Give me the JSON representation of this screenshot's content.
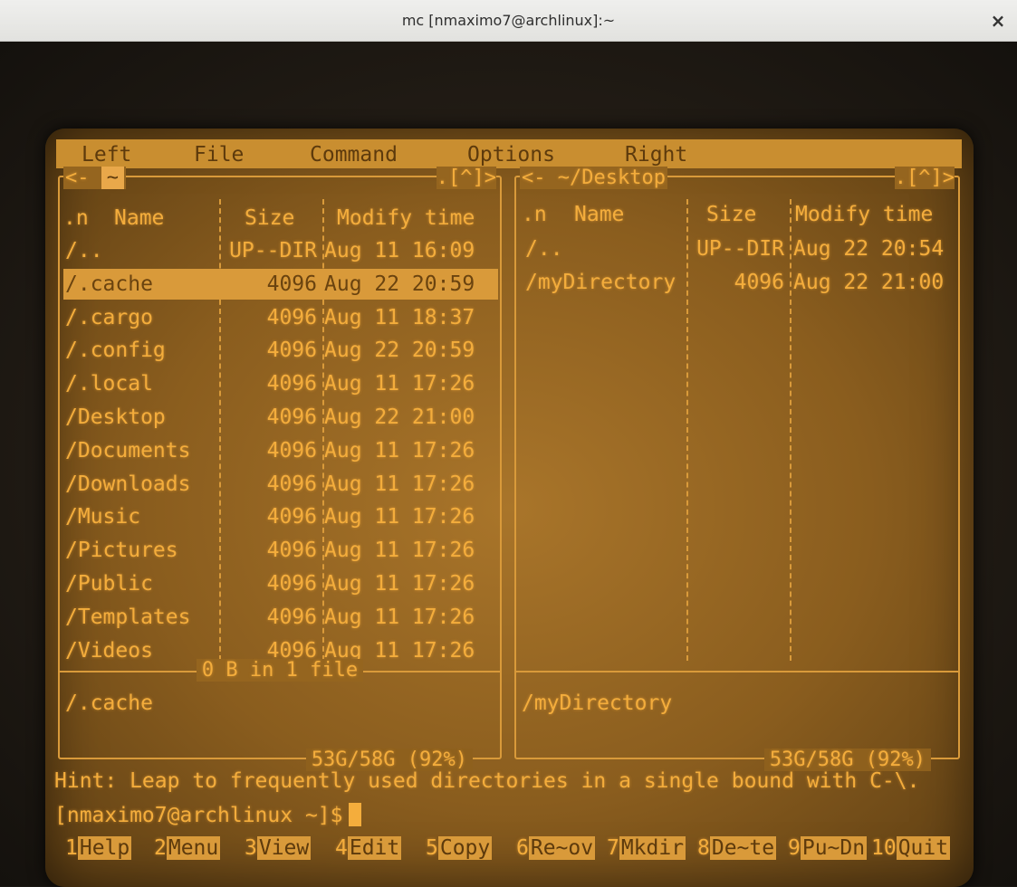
{
  "window": {
    "title": "mc [nmaximo7@archlinux]:~",
    "close_label": "×"
  },
  "menu": [
    "Left",
    "File",
    "Command",
    "Options",
    "Right"
  ],
  "left_panel": {
    "path": "~",
    "corner": ".[^]>",
    "headers": {
      "n": ".n",
      "name": "Name",
      "size": "Size",
      "mtime": "Modify time"
    },
    "rows": [
      {
        "name": "/..",
        "size": "UP--DIR",
        "mtime": "Aug 11 16:09"
      },
      {
        "name": "/.cache",
        "size": "4096",
        "mtime": "Aug 22 20:59"
      },
      {
        "name": "/.cargo",
        "size": "4096",
        "mtime": "Aug 11 18:37"
      },
      {
        "name": "/.config",
        "size": "4096",
        "mtime": "Aug 22 20:59"
      },
      {
        "name": "/.local",
        "size": "4096",
        "mtime": "Aug 11 17:26"
      },
      {
        "name": "/Desktop",
        "size": "4096",
        "mtime": "Aug 22 21:00"
      },
      {
        "name": "/Documents",
        "size": "4096",
        "mtime": "Aug 11 17:26"
      },
      {
        "name": "/Downloads",
        "size": "4096",
        "mtime": "Aug 11 17:26"
      },
      {
        "name": "/Music",
        "size": "4096",
        "mtime": "Aug 11 17:26"
      },
      {
        "name": "/Pictures",
        "size": "4096",
        "mtime": "Aug 11 17:26"
      },
      {
        "name": "/Public",
        "size": "4096",
        "mtime": "Aug 11 17:26"
      },
      {
        "name": "/Templates",
        "size": "4096",
        "mtime": "Aug 11 17:26"
      },
      {
        "name": "/Videos",
        "size": "4096",
        "mtime": "Aug 11 17:26"
      }
    ],
    "selected_index": 1,
    "mini_info": "0 B in 1 file",
    "mini_name": "/.cache",
    "disk": "53G/58G (92%)"
  },
  "right_panel": {
    "path": "<- ~/Desktop",
    "corner": ".[^]>",
    "headers": {
      "n": ".n",
      "name": "Name",
      "size": "Size",
      "mtime": "Modify time"
    },
    "rows": [
      {
        "name": "/..",
        "size": "UP--DIR",
        "mtime": "Aug 22 20:54"
      },
      {
        "name": "/myDirectory",
        "size": "4096",
        "mtime": "Aug 22 21:00"
      }
    ],
    "mini_name": "/myDirectory",
    "disk": "53G/58G (92%)"
  },
  "hint": "Hint: Leap to frequently used directories in a single bound with C-\\.",
  "prompt": "[nmaximo7@archlinux ~]$",
  "fkeys": [
    {
      "num": "1",
      "label": "Help"
    },
    {
      "num": "2",
      "label": "Menu"
    },
    {
      "num": "3",
      "label": "View"
    },
    {
      "num": "4",
      "label": "Edit"
    },
    {
      "num": "5",
      "label": "Copy"
    },
    {
      "num": "6",
      "label": "Re~ov"
    },
    {
      "num": "7",
      "label": "Mkdir"
    },
    {
      "num": "8",
      "label": "De~te"
    },
    {
      "num": "9",
      "label": "Pu~Dn"
    },
    {
      "num": "10",
      "label": "Quit"
    }
  ]
}
